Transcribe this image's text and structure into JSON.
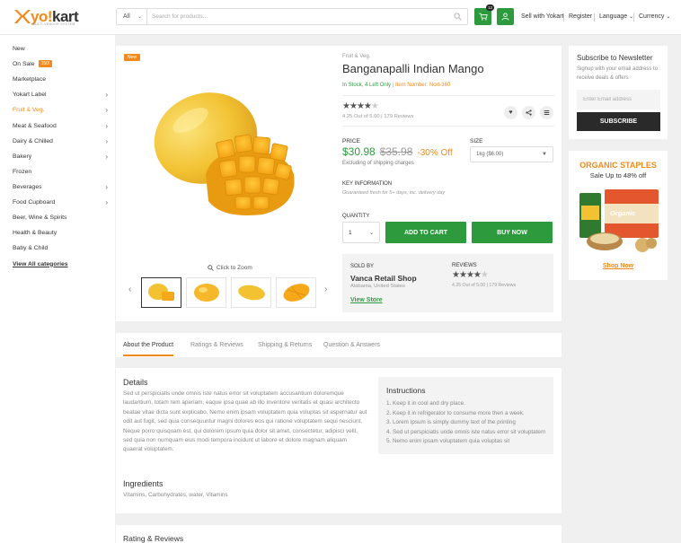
{
  "header": {
    "logo_main": "yo!kart",
    "logo_tagline": "MULTI-VENDOR SYSTEM",
    "search": {
      "category": "All",
      "placeholder": "Search for products..."
    },
    "cart_count": "12",
    "links": {
      "sell": "Sell with Yokart",
      "register": "Register",
      "language": "Language",
      "currency": "Currency"
    }
  },
  "sidebar": {
    "items": [
      {
        "label": "New"
      },
      {
        "label": "On Sale",
        "badge": "150!"
      },
      {
        "label": "Marketplace"
      },
      {
        "label": "Yokart Label"
      },
      {
        "label": "Fruit & Veg."
      },
      {
        "label": "Meat & Seafood"
      },
      {
        "label": "Dairy & Chilled"
      },
      {
        "label": "Bakery"
      },
      {
        "label": "Frozen"
      },
      {
        "label": "Beverages"
      },
      {
        "label": "Food Cupboard"
      },
      {
        "label": "Beer, Wine & Spirits"
      },
      {
        "label": "Health & Beauty"
      },
      {
        "label": "Baby & Child"
      },
      {
        "label": "View All categories"
      }
    ]
  },
  "product": {
    "badge": "New",
    "category": "Fruit & Veg.",
    "name": "Banganapalli Indian Mango",
    "stock": "In Stock, 4 Left Only",
    "item_number": "Item Number: Nort-360",
    "rating": 4.25,
    "rating_text": "4.25 Out of 5.00 | 179 Reviews",
    "zoom_label": "Click to Zoom",
    "price_label": "PRICE",
    "price": "$30.98",
    "old_price": "$35.98",
    "discount": "-30% Off",
    "shipping_note": "Excluding of shipping charges",
    "size_label": "SIZE",
    "size_value": "1kg ($6.00)",
    "key_info_label": "KEY INFORMATION",
    "key_info": "Guaranteed fresh for 5+ days, inc. delivery day",
    "quantity_label": "QUANTITY",
    "quantity": "1",
    "add_to_cart": "ADD TO CART",
    "buy_now": "BUY NOW"
  },
  "seller": {
    "sold_by_label": "SOLD BY",
    "name": "Vanca Retail Shop",
    "location": "Alabama, United States",
    "view_store": "View Store",
    "reviews_label": "REVIEWS",
    "rating": 4.25,
    "rating_text": "4.25 Out of 5.00 | 179 Reviews"
  },
  "tabs": [
    "About the Product",
    "Ratings & Reviews",
    "Shipping & Returns",
    "Question & Answers"
  ],
  "details": {
    "title": "Details",
    "text": "Sed ut perspiciatis unde omnis iste natus error sit voluptatem accusantium doloremque laudantium, totam rem aperiam, eaque ipsa quae ab illo inventore veritatis et quasi architecto beatae vitae dicta sunt explicabo. Nemo enim ipsam voluptatem quia voluptas sit aspernatur aut odit aut fugit, sed quia consequuntur magni dolores eos qui ratione voluptatem sequi nesciunt. Neque porro quisquam est, qui dolorem ipsum quia dolor sit amet, consectetur, adipisci velit, sed quia non numquam eius modi tempora incidunt ut labore et dolore magnam aliquam quaerat voluptatem.",
    "ingredients_title": "Ingredients",
    "ingredients": "Vitamins, Carbohydrates, water, Vitamins"
  },
  "instructions": {
    "title": "Instructions",
    "items": [
      "1. Keep it in cool and dry place.",
      "2. Keep it in refrigerator to consume more then a week.",
      "3. Lorem Ipsum is simply dummy text of the printing",
      "4. Sed ut perspiciatis unde omnis iste natus error sit voluptatem",
      "5. Nemo enim ipsam voluptatem quia voluptas sit"
    ]
  },
  "ratings_section_title": "Rating & Reviews",
  "newsletter": {
    "title": "Subscribe to Newsletter",
    "text": "Signup with your email address to receive deals & offers",
    "placeholder": "Enter Email address",
    "button": "SUBSCRIBE"
  },
  "promo": {
    "title": "ORGANIC STAPLES",
    "subtitle": "Sale Up to 48% off",
    "link": "Shop Now",
    "pack_label": "Organic"
  },
  "colors": {
    "brand_orange": "#f28a1b",
    "brand_green": "#2e9a3e",
    "dark": "#2a2a2a"
  }
}
